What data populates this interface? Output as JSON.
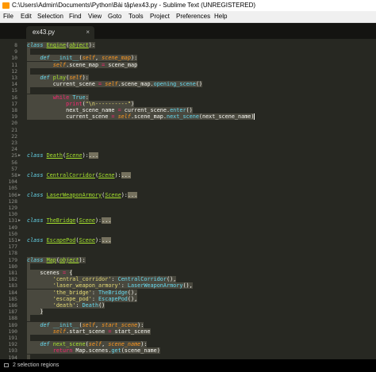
{
  "window": {
    "title": "C:\\Users\\Admin\\Documents\\Python\\Bài tập\\ex43.py - Sublime Text (UNREGISTERED)"
  },
  "menu": [
    "File",
    "Edit",
    "Selection",
    "Find",
    "View",
    "Goto",
    "Tools",
    "Project",
    "Preferences",
    "Help"
  ],
  "tab": {
    "label": "ex43.py",
    "close_glyph": "×"
  },
  "editor": {
    "lines": [
      {
        "n": "8",
        "tokens": [
          {
            "t": "class ",
            "c": "k-kw"
          },
          {
            "t": "Engine",
            "c": "k-cls"
          },
          {
            "t": "(",
            "c": "k-text"
          },
          {
            "t": "object",
            "c": "k-inh"
          },
          {
            "t": "):",
            "c": "k-text"
          }
        ],
        "sel": true
      },
      {
        "n": "9",
        "tokens": [],
        "sel": true
      },
      {
        "n": "10",
        "tokens": [
          {
            "t": "    ",
            "c": "ws"
          },
          {
            "t": "def ",
            "c": "k-kw"
          },
          {
            "t": "__init__",
            "c": "k-sup"
          },
          {
            "t": "(",
            "c": "k-text"
          },
          {
            "t": "self",
            "c": "k-self"
          },
          {
            "t": ", ",
            "c": "k-text"
          },
          {
            "t": "scene_map",
            "c": "k-param"
          },
          {
            "t": "):",
            "c": "k-text"
          }
        ],
        "sel": true
      },
      {
        "n": "11",
        "tokens": [
          {
            "t": "        ",
            "c": "ws"
          },
          {
            "t": "self",
            "c": "k-self"
          },
          {
            "t": ".scene_map ",
            "c": "k-text"
          },
          {
            "t": "=",
            "c": "k-op"
          },
          {
            "t": " scene_map",
            "c": "k-text"
          }
        ],
        "sel": true
      },
      {
        "n": "12",
        "tokens": [],
        "sel": true
      },
      {
        "n": "13",
        "tokens": [
          {
            "t": "    ",
            "c": "ws"
          },
          {
            "t": "def ",
            "c": "k-kw"
          },
          {
            "t": "play",
            "c": "k-fn"
          },
          {
            "t": "(",
            "c": "k-text"
          },
          {
            "t": "self",
            "c": "k-self"
          },
          {
            "t": "):",
            "c": "k-text"
          }
        ],
        "sel": true
      },
      {
        "n": "14",
        "tokens": [
          {
            "t": "        ",
            "c": "ws"
          },
          {
            "t": "current_scene ",
            "c": "k-text"
          },
          {
            "t": "=",
            "c": "k-op"
          },
          {
            "t": " ",
            "c": "k-text"
          },
          {
            "t": "self",
            "c": "k-self"
          },
          {
            "t": ".scene_map.",
            "c": "k-text"
          },
          {
            "t": "opening_scene",
            "c": "k-blue"
          },
          {
            "t": "()",
            "c": "k-text"
          }
        ],
        "sel": true
      },
      {
        "n": "15",
        "tokens": [],
        "sel": true
      },
      {
        "n": "16",
        "tokens": [
          {
            "t": "        ",
            "c": "ws"
          },
          {
            "t": "while ",
            "c": "k-storage"
          },
          {
            "t": "True",
            "c": "k-sup"
          },
          {
            "t": ":",
            "c": "k-text"
          }
        ],
        "sel": true
      },
      {
        "n": "17",
        "tokens": [
          {
            "t": "            ",
            "c": "ws"
          },
          {
            "t": "print",
            "c": "k-storage"
          },
          {
            "t": "(",
            "c": "k-text"
          },
          {
            "t": "\"\\n----------\"",
            "c": "k-str"
          },
          {
            "t": ")",
            "c": "k-text"
          }
        ],
        "sel": true
      },
      {
        "n": "18",
        "tokens": [
          {
            "t": "            ",
            "c": "ws"
          },
          {
            "t": "next_scene_name ",
            "c": "k-text"
          },
          {
            "t": "=",
            "c": "k-op"
          },
          {
            "t": " current_scene.",
            "c": "k-text"
          },
          {
            "t": "enter",
            "c": "k-blue"
          },
          {
            "t": "()",
            "c": "k-text"
          }
        ],
        "sel": true
      },
      {
        "n": "19",
        "tokens": [
          {
            "t": "            ",
            "c": "ws"
          },
          {
            "t": "current_scene ",
            "c": "k-text"
          },
          {
            "t": "=",
            "c": "k-op"
          },
          {
            "t": " ",
            "c": "k-text"
          },
          {
            "t": "self",
            "c": "k-self"
          },
          {
            "t": ".scene_map.",
            "c": "k-text"
          },
          {
            "t": "next_scene",
            "c": "k-blue"
          },
          {
            "t": "(next_scene_name)",
            "c": "k-text"
          }
        ],
        "sel": true,
        "cur": true
      },
      {
        "n": "20",
        "tokens": []
      },
      {
        "n": "21",
        "tokens": []
      },
      {
        "n": "22",
        "tokens": []
      },
      {
        "n": "23",
        "tokens": []
      },
      {
        "n": "24",
        "tokens": []
      },
      {
        "n": "25",
        "tokens": [
          {
            "t": "class ",
            "c": "k-kw"
          },
          {
            "t": "Death",
            "c": "k-cls"
          },
          {
            "t": "(",
            "c": "k-text"
          },
          {
            "t": "Scene",
            "c": "k-inh"
          },
          {
            "t": "):",
            "c": "k-text"
          },
          {
            "t": "...",
            "c": "k-dots"
          }
        ]
      },
      {
        "n": "56",
        "tokens": []
      },
      {
        "n": "57",
        "tokens": []
      },
      {
        "n": "58",
        "tokens": [
          {
            "t": "class ",
            "c": "k-kw"
          },
          {
            "t": "CentralCorridor",
            "c": "k-cls"
          },
          {
            "t": "(",
            "c": "k-text"
          },
          {
            "t": "Scene",
            "c": "k-inh"
          },
          {
            "t": "):",
            "c": "k-text"
          },
          {
            "t": "...",
            "c": "k-dots"
          }
        ]
      },
      {
        "n": "104",
        "tokens": []
      },
      {
        "n": "105",
        "tokens": []
      },
      {
        "n": "106",
        "tokens": [
          {
            "t": "class ",
            "c": "k-kw"
          },
          {
            "t": "LaserWeaponArmory",
            "c": "k-cls"
          },
          {
            "t": "(",
            "c": "k-text"
          },
          {
            "t": "Scene",
            "c": "k-inh"
          },
          {
            "t": "):",
            "c": "k-text"
          },
          {
            "t": "...",
            "c": "k-dots"
          }
        ]
      },
      {
        "n": "128",
        "tokens": []
      },
      {
        "n": "129",
        "tokens": []
      },
      {
        "n": "130",
        "tokens": []
      },
      {
        "n": "131",
        "tokens": [
          {
            "t": "class ",
            "c": "k-kw"
          },
          {
            "t": "TheBridge",
            "c": "k-cls"
          },
          {
            "t": "(",
            "c": "k-text"
          },
          {
            "t": "Scene",
            "c": "k-inh"
          },
          {
            "t": "):",
            "c": "k-text"
          },
          {
            "t": "...",
            "c": "k-dots"
          }
        ]
      },
      {
        "n": "149",
        "tokens": []
      },
      {
        "n": "150",
        "tokens": []
      },
      {
        "n": "151",
        "tokens": [
          {
            "t": "class ",
            "c": "k-kw"
          },
          {
            "t": "EscapePod",
            "c": "k-cls"
          },
          {
            "t": "(",
            "c": "k-text"
          },
          {
            "t": "Scene",
            "c": "k-inh"
          },
          {
            "t": "):",
            "c": "k-text"
          },
          {
            "t": "...",
            "c": "k-dots"
          }
        ]
      },
      {
        "n": "177",
        "tokens": []
      },
      {
        "n": "178",
        "tokens": []
      },
      {
        "n": "179",
        "tokens": [
          {
            "t": "class ",
            "c": "k-kw"
          },
          {
            "t": "Map",
            "c": "k-cls"
          },
          {
            "t": "(",
            "c": "k-text"
          },
          {
            "t": "object",
            "c": "k-inh"
          },
          {
            "t": "):",
            "c": "k-text"
          }
        ],
        "sel": true
      },
      {
        "n": "180",
        "tokens": [],
        "sel": true
      },
      {
        "n": "181",
        "tokens": [
          {
            "t": "    ",
            "c": "ws"
          },
          {
            "t": "scenes ",
            "c": "k-text"
          },
          {
            "t": "=",
            "c": "k-op"
          },
          {
            "t": " {",
            "c": "k-text"
          }
        ],
        "sel": true
      },
      {
        "n": "182",
        "tokens": [
          {
            "t": "        ",
            "c": "ws"
          },
          {
            "t": "'central_corridor'",
            "c": "k-str"
          },
          {
            "t": ": ",
            "c": "k-text"
          },
          {
            "t": "CentralCorridor",
            "c": "k-blue"
          },
          {
            "t": "(),",
            "c": "k-text"
          }
        ],
        "sel": true
      },
      {
        "n": "183",
        "tokens": [
          {
            "t": "        ",
            "c": "ws"
          },
          {
            "t": "'laser_weapon_armory'",
            "c": "k-str"
          },
          {
            "t": ": ",
            "c": "k-text"
          },
          {
            "t": "LaserWeaponArmory",
            "c": "k-blue"
          },
          {
            "t": "(),",
            "c": "k-text"
          }
        ],
        "sel": true
      },
      {
        "n": "184",
        "tokens": [
          {
            "t": "        ",
            "c": "ws"
          },
          {
            "t": "'the_bridge'",
            "c": "k-str"
          },
          {
            "t": ": ",
            "c": "k-text"
          },
          {
            "t": "TheBridge",
            "c": "k-blue"
          },
          {
            "t": "(),",
            "c": "k-text"
          }
        ],
        "sel": true
      },
      {
        "n": "185",
        "tokens": [
          {
            "t": "        ",
            "c": "ws"
          },
          {
            "t": "'escape_pod'",
            "c": "k-str"
          },
          {
            "t": ": ",
            "c": "k-text"
          },
          {
            "t": "EscapePod",
            "c": "k-blue"
          },
          {
            "t": "(),",
            "c": "k-text"
          }
        ],
        "sel": true
      },
      {
        "n": "186",
        "tokens": [
          {
            "t": "        ",
            "c": "ws"
          },
          {
            "t": "'death'",
            "c": "k-str"
          },
          {
            "t": ": ",
            "c": "k-text"
          },
          {
            "t": "Death",
            "c": "k-blue"
          },
          {
            "t": "()",
            "c": "k-text"
          }
        ],
        "sel": true
      },
      {
        "n": "187",
        "tokens": [
          {
            "t": "    ",
            "c": "ws"
          },
          {
            "t": "}",
            "c": "k-text"
          }
        ],
        "sel": true
      },
      {
        "n": "188",
        "tokens": [],
        "sel": true
      },
      {
        "n": "189",
        "tokens": [
          {
            "t": "    ",
            "c": "ws"
          },
          {
            "t": "def ",
            "c": "k-kw"
          },
          {
            "t": "__init__",
            "c": "k-sup"
          },
          {
            "t": "(",
            "c": "k-text"
          },
          {
            "t": "self",
            "c": "k-self"
          },
          {
            "t": ", ",
            "c": "k-text"
          },
          {
            "t": "start_scene",
            "c": "k-param"
          },
          {
            "t": "):",
            "c": "k-text"
          }
        ],
        "sel": true
      },
      {
        "n": "190",
        "tokens": [
          {
            "t": "        ",
            "c": "ws"
          },
          {
            "t": "self",
            "c": "k-self"
          },
          {
            "t": ".start_scene ",
            "c": "k-text"
          },
          {
            "t": "=",
            "c": "k-op"
          },
          {
            "t": " start_scene",
            "c": "k-text"
          }
        ],
        "sel": true
      },
      {
        "n": "191",
        "tokens": [],
        "sel": true
      },
      {
        "n": "192",
        "tokens": [
          {
            "t": "    ",
            "c": "ws"
          },
          {
            "t": "def ",
            "c": "k-kw"
          },
          {
            "t": "next_scene",
            "c": "k-fn"
          },
          {
            "t": "(",
            "c": "k-text"
          },
          {
            "t": "self",
            "c": "k-self"
          },
          {
            "t": ", ",
            "c": "k-text"
          },
          {
            "t": "scene_name",
            "c": "k-param"
          },
          {
            "t": "):",
            "c": "k-text"
          }
        ],
        "sel": true
      },
      {
        "n": "193",
        "tokens": [
          {
            "t": "        ",
            "c": "ws"
          },
          {
            "t": "return ",
            "c": "k-storage"
          },
          {
            "t": "Map.scenes.",
            "c": "k-text"
          },
          {
            "t": "get",
            "c": "k-blue"
          },
          {
            "t": "(scene_name)",
            "c": "k-text"
          }
        ],
        "sel": true
      },
      {
        "n": "194",
        "tokens": [],
        "sel": true
      },
      {
        "n": "195",
        "tokens": [
          {
            "t": "    ",
            "c": "ws"
          },
          {
            "t": "def ",
            "c": "k-kw"
          },
          {
            "t": "opening_scene",
            "c": "k-fn"
          },
          {
            "t": "(",
            "c": "k-text"
          },
          {
            "t": "self",
            "c": "k-self"
          },
          {
            "t": "):",
            "c": "k-text"
          }
        ],
        "sel": true
      },
      {
        "n": "196",
        "tokens": [
          {
            "t": "        ",
            "c": "ws"
          },
          {
            "t": "return ",
            "c": "k-storage"
          },
          {
            "t": "self",
            "c": "k-self"
          },
          {
            "t": ".",
            "c": "k-text"
          },
          {
            "t": "next_scene",
            "c": "k-blue"
          },
          {
            "t": "(",
            "c": "k-text"
          },
          {
            "t": "self",
            "c": "k-self"
          },
          {
            "t": ".start_scene)",
            "c": "k-text"
          }
        ],
        "sel": true
      },
      {
        "n": "197",
        "tokens": []
      },
      {
        "n": "198",
        "tokens": []
      }
    ]
  },
  "status": {
    "text": "2 selection regions"
  },
  "colors": {
    "background": "#272822",
    "selection": "#49483e",
    "keyword": "#66d9ef",
    "class_name": "#a6e22e",
    "string": "#e6db74",
    "operator": "#f92672",
    "parameter": "#fd971f"
  }
}
